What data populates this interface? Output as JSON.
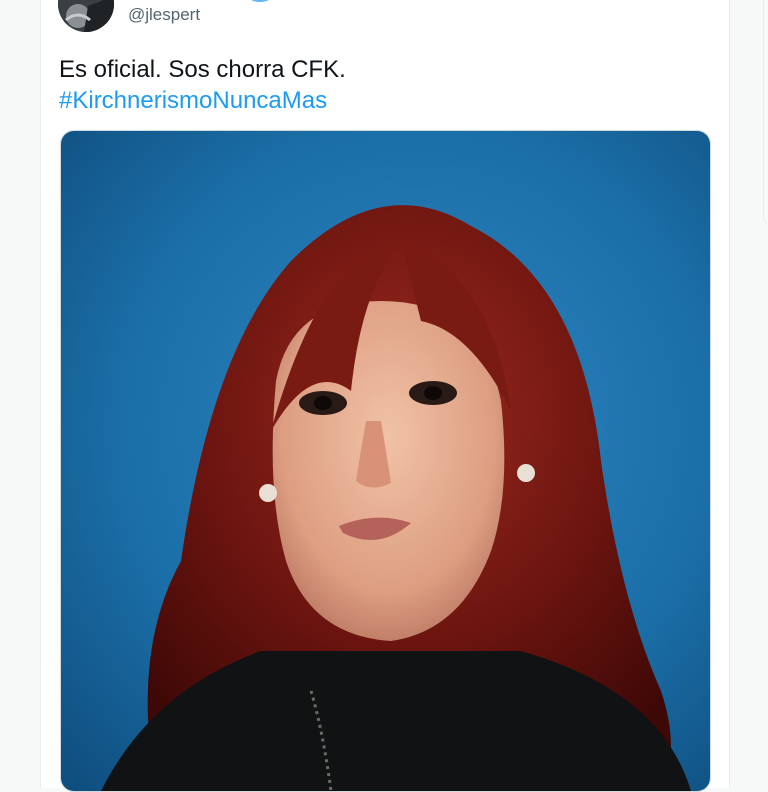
{
  "tweet": {
    "handle": "@jlespert",
    "text": "Es oficial. Sos chorra CFK.",
    "hashtag": "#KirchnerismoNuncaMas"
  },
  "colors": {
    "hashtag": "#1d9bf0",
    "handle": "#536471",
    "text": "#0f1419",
    "photo_background": "#1b6fa8"
  },
  "icons": [
    "avatar",
    "verified-badge"
  ]
}
